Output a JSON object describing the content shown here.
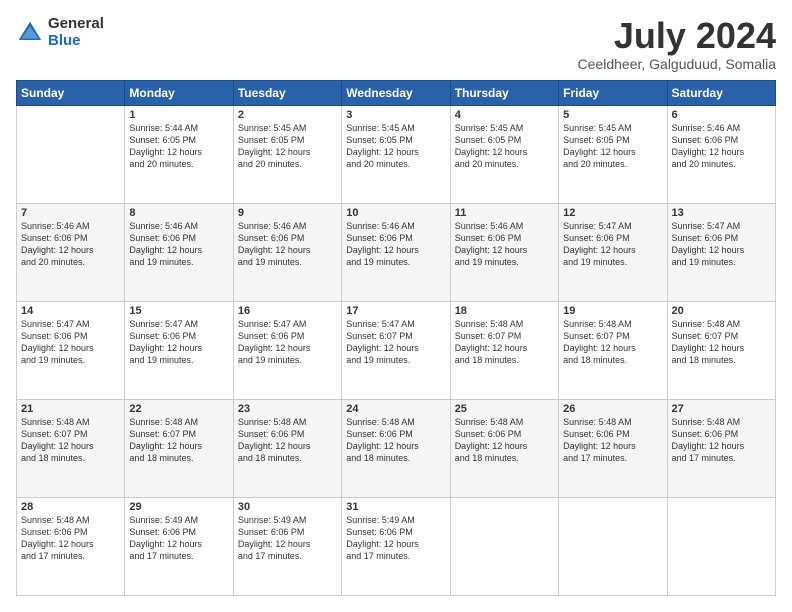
{
  "logo": {
    "general": "General",
    "blue": "Blue"
  },
  "title": "July 2024",
  "location": "Ceeldheer, Galguduud, Somalia",
  "days_header": [
    "Sunday",
    "Monday",
    "Tuesday",
    "Wednesday",
    "Thursday",
    "Friday",
    "Saturday"
  ],
  "weeks": [
    [
      {
        "day": "",
        "info": ""
      },
      {
        "day": "1",
        "info": "Sunrise: 5:44 AM\nSunset: 6:05 PM\nDaylight: 12 hours\nand 20 minutes."
      },
      {
        "day": "2",
        "info": "Sunrise: 5:45 AM\nSunset: 6:05 PM\nDaylight: 12 hours\nand 20 minutes."
      },
      {
        "day": "3",
        "info": "Sunrise: 5:45 AM\nSunset: 6:05 PM\nDaylight: 12 hours\nand 20 minutes."
      },
      {
        "day": "4",
        "info": "Sunrise: 5:45 AM\nSunset: 6:05 PM\nDaylight: 12 hours\nand 20 minutes."
      },
      {
        "day": "5",
        "info": "Sunrise: 5:45 AM\nSunset: 6:05 PM\nDaylight: 12 hours\nand 20 minutes."
      },
      {
        "day": "6",
        "info": "Sunrise: 5:46 AM\nSunset: 6:06 PM\nDaylight: 12 hours\nand 20 minutes."
      }
    ],
    [
      {
        "day": "7",
        "info": "Sunrise: 5:46 AM\nSunset: 6:06 PM\nDaylight: 12 hours\nand 20 minutes."
      },
      {
        "day": "8",
        "info": "Sunrise: 5:46 AM\nSunset: 6:06 PM\nDaylight: 12 hours\nand 19 minutes."
      },
      {
        "day": "9",
        "info": "Sunrise: 5:46 AM\nSunset: 6:06 PM\nDaylight: 12 hours\nand 19 minutes."
      },
      {
        "day": "10",
        "info": "Sunrise: 5:46 AM\nSunset: 6:06 PM\nDaylight: 12 hours\nand 19 minutes."
      },
      {
        "day": "11",
        "info": "Sunrise: 5:46 AM\nSunset: 6:06 PM\nDaylight: 12 hours\nand 19 minutes."
      },
      {
        "day": "12",
        "info": "Sunrise: 5:47 AM\nSunset: 6:06 PM\nDaylight: 12 hours\nand 19 minutes."
      },
      {
        "day": "13",
        "info": "Sunrise: 5:47 AM\nSunset: 6:06 PM\nDaylight: 12 hours\nand 19 minutes."
      }
    ],
    [
      {
        "day": "14",
        "info": "Sunrise: 5:47 AM\nSunset: 6:06 PM\nDaylight: 12 hours\nand 19 minutes."
      },
      {
        "day": "15",
        "info": "Sunrise: 5:47 AM\nSunset: 6:06 PM\nDaylight: 12 hours\nand 19 minutes."
      },
      {
        "day": "16",
        "info": "Sunrise: 5:47 AM\nSunset: 6:06 PM\nDaylight: 12 hours\nand 19 minutes."
      },
      {
        "day": "17",
        "info": "Sunrise: 5:47 AM\nSunset: 6:07 PM\nDaylight: 12 hours\nand 19 minutes."
      },
      {
        "day": "18",
        "info": "Sunrise: 5:48 AM\nSunset: 6:07 PM\nDaylight: 12 hours\nand 18 minutes."
      },
      {
        "day": "19",
        "info": "Sunrise: 5:48 AM\nSunset: 6:07 PM\nDaylight: 12 hours\nand 18 minutes."
      },
      {
        "day": "20",
        "info": "Sunrise: 5:48 AM\nSunset: 6:07 PM\nDaylight: 12 hours\nand 18 minutes."
      }
    ],
    [
      {
        "day": "21",
        "info": "Sunrise: 5:48 AM\nSunset: 6:07 PM\nDaylight: 12 hours\nand 18 minutes."
      },
      {
        "day": "22",
        "info": "Sunrise: 5:48 AM\nSunset: 6:07 PM\nDaylight: 12 hours\nand 18 minutes."
      },
      {
        "day": "23",
        "info": "Sunrise: 5:48 AM\nSunset: 6:06 PM\nDaylight: 12 hours\nand 18 minutes."
      },
      {
        "day": "24",
        "info": "Sunrise: 5:48 AM\nSunset: 6:06 PM\nDaylight: 12 hours\nand 18 minutes."
      },
      {
        "day": "25",
        "info": "Sunrise: 5:48 AM\nSunset: 6:06 PM\nDaylight: 12 hours\nand 18 minutes."
      },
      {
        "day": "26",
        "info": "Sunrise: 5:48 AM\nSunset: 6:06 PM\nDaylight: 12 hours\nand 17 minutes."
      },
      {
        "day": "27",
        "info": "Sunrise: 5:48 AM\nSunset: 6:06 PM\nDaylight: 12 hours\nand 17 minutes."
      }
    ],
    [
      {
        "day": "28",
        "info": "Sunrise: 5:48 AM\nSunset: 6:06 PM\nDaylight: 12 hours\nand 17 minutes."
      },
      {
        "day": "29",
        "info": "Sunrise: 5:49 AM\nSunset: 6:06 PM\nDaylight: 12 hours\nand 17 minutes."
      },
      {
        "day": "30",
        "info": "Sunrise: 5:49 AM\nSunset: 6:06 PM\nDaylight: 12 hours\nand 17 minutes."
      },
      {
        "day": "31",
        "info": "Sunrise: 5:49 AM\nSunset: 6:06 PM\nDaylight: 12 hours\nand 17 minutes."
      },
      {
        "day": "",
        "info": ""
      },
      {
        "day": "",
        "info": ""
      },
      {
        "day": "",
        "info": ""
      }
    ]
  ]
}
